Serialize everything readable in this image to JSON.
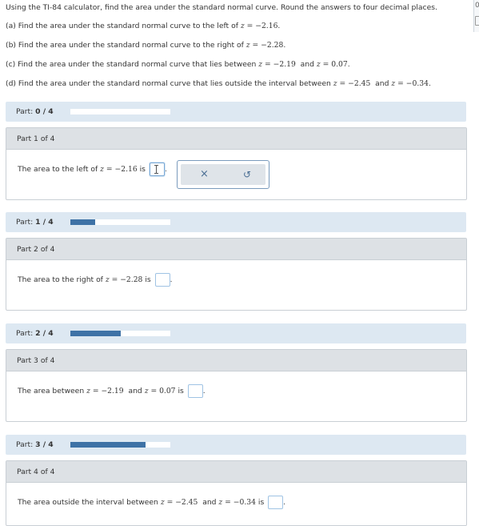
{
  "intro": "Using the TI-84 calculator, find the area under the standard normal curve. Round the answers to four decimal places.",
  "questions": {
    "a_pre": "(a) Find the area under the standard normal curve to the left of",
    "a_z": "z",
    "a_val": " = −2.16",
    "b_pre": "(b) Find the area under the standard normal curve to the right of",
    "b_z": "z",
    "b_val": " = −2.28",
    "c_pre": "(c) Find the area under the standard normal curve that lies between",
    "c_z1": "z",
    "c_val1": " = −2.19",
    "c_and": "and",
    "c_z2": "z",
    "c_val2": " = 0.07",
    "d_pre": "(d) Find the area under the standard normal curve that lies outside the interval between",
    "d_z1": "z",
    "d_val1": " = −2.45",
    "d_and": "and",
    "d_z2": "z",
    "d_val2": " = −0.34",
    "period": "."
  },
  "edge_tab_text": "0",
  "part_bars": [
    {
      "label": "Part:",
      "value": "0 / 4",
      "progress": 0.0
    },
    {
      "label": "Part:",
      "value": "1 / 4",
      "progress": 0.25
    },
    {
      "label": "Part:",
      "value": "2 / 4",
      "progress": 0.5
    },
    {
      "label": "Part:",
      "value": "3 / 4",
      "progress": 0.75
    }
  ],
  "parts": [
    {
      "title": "Part 1 of 4",
      "pre": "The area to the left of",
      "z": "z",
      "val": " = −2.16",
      "is": "is",
      "end": "."
    },
    {
      "title": "Part 2 of 4",
      "pre": "The area to the right of",
      "z": "z",
      "val": " = −2.28",
      "is": "is",
      "end": "."
    },
    {
      "title": "Part 3 of 4",
      "pre": "The area between",
      "z1": "z",
      "val1": " = −2.19",
      "and": "and",
      "z2": "z",
      "val2": " = 0.07",
      "is": "is",
      "end": "."
    },
    {
      "title": "Part 4 of 4",
      "pre": "The area outside the interval between",
      "z1": "z",
      "val1": " = −2.45",
      "and": "and",
      "z2": "z",
      "val2": " = −0.34",
      "is": "is",
      "end": "."
    }
  ],
  "toolbox": {
    "clear_glyph": "×",
    "undo_glyph": "↺",
    "clear_icon": "close-icon",
    "undo_icon": "undo-icon"
  },
  "colors": {
    "progress_fill": "#3e72a6",
    "part_bar_bg": "#dde8f2",
    "panel_head_bg": "#dde1e5"
  }
}
